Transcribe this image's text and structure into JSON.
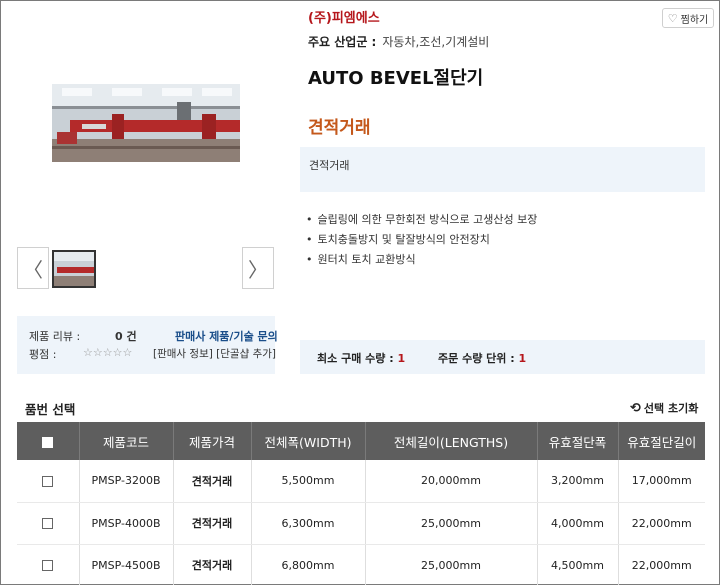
{
  "seller": {
    "name": "(주)피엠에스",
    "industry_label": "주요 산업군 :",
    "industry_value": "자동차,조선,기계설비"
  },
  "wishlist": {
    "label": "찜하기",
    "icon": "heart-icon"
  },
  "product": {
    "title": "AUTO BEVEL절단기",
    "price_label": "견적거래",
    "price_note": "견적거래",
    "features": [
      "슬립링에 의한 무한회전 방식으로 고생산성 보장",
      "토치충돌방지 및 탈잘방식의 안전장치",
      "원터치 토치 교환방식"
    ]
  },
  "gallery": {
    "prev_icon": "chevron-left-icon",
    "next_icon": "chevron-right-icon",
    "prev_glyph": "〈",
    "next_glyph": "〉"
  },
  "review": {
    "label": "제품 리뷰 :",
    "count": "0 건",
    "inquiry_link": "판매사 제품/기술 문의",
    "rating_label": "평점 :",
    "stars": "☆☆☆☆☆",
    "links": "[판매사 정보] [단골샵 추가]"
  },
  "purchase": {
    "min_label": "최소 구매 수량 : ",
    "min_value": "1",
    "unit_label": "주문 수량 단위 : ",
    "unit_value": "1"
  },
  "options": {
    "title": "품번 선택",
    "reset_label": "선택 초기화",
    "columns": [
      "제품코드",
      "제품가격",
      "전체폭(WIDTH)",
      "전체길이(LENGTHS)",
      "유효절단폭",
      "유효절단길이"
    ],
    "rows": [
      {
        "code": "PMSP-3200B",
        "price": "견적거래",
        "width": "5,500mm",
        "length": "20,000mm",
        "cut_width": "3,200mm",
        "cut_length": "17,000mm"
      },
      {
        "code": "PMSP-4000B",
        "price": "견적거래",
        "width": "6,300mm",
        "length": "25,000mm",
        "cut_width": "4,000mm",
        "cut_length": "22,000mm"
      },
      {
        "code": "PMSP-4500B",
        "price": "견적거래",
        "width": "6,800mm",
        "length": "25,000mm",
        "cut_width": "4,500mm",
        "cut_length": "22,000mm"
      }
    ]
  },
  "colors": {
    "brand": "#b5161b",
    "price": "#c4581b",
    "link": "#1a4e8a",
    "table_header": "#5e5e5e",
    "info_bg": "#eef4fa"
  }
}
